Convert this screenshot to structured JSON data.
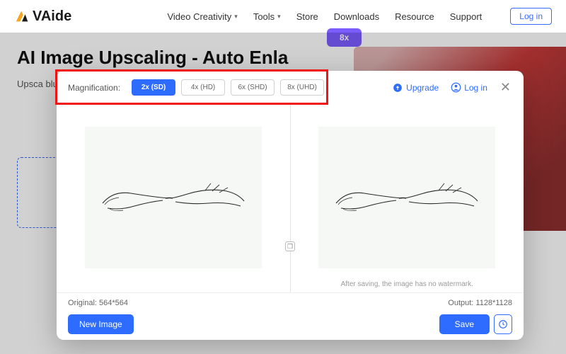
{
  "brand": {
    "name": "VAide"
  },
  "nav": {
    "items": [
      {
        "label": "Video Creativity",
        "hasMenu": true
      },
      {
        "label": "Tools",
        "hasMenu": true
      },
      {
        "label": "Store",
        "hasMenu": false
      },
      {
        "label": "Downloads",
        "hasMenu": false
      },
      {
        "label": "Resource",
        "hasMenu": false
      },
      {
        "label": "Support",
        "hasMenu": false
      }
    ],
    "login": "Log in"
  },
  "hero": {
    "title": "AI Image Upscaling - Auto Enla",
    "subtitle": "Upsca\nblurry",
    "badge": "8x"
  },
  "modal": {
    "magnificationLabel": "Magnification:",
    "options": [
      {
        "label": "2x (SD)",
        "active": true
      },
      {
        "label": "4x (HD)",
        "active": false
      },
      {
        "label": "6x (SHD)",
        "active": false
      },
      {
        "label": "8x (UHD)",
        "active": false
      }
    ],
    "upgrade": "Upgrade",
    "login": "Log in",
    "watermarkNote": "After saving, the image has no watermark.",
    "originalLabel": "Original: 564*564",
    "outputLabel": "Output: 1128*1128",
    "newImage": "New Image",
    "save": "Save"
  }
}
